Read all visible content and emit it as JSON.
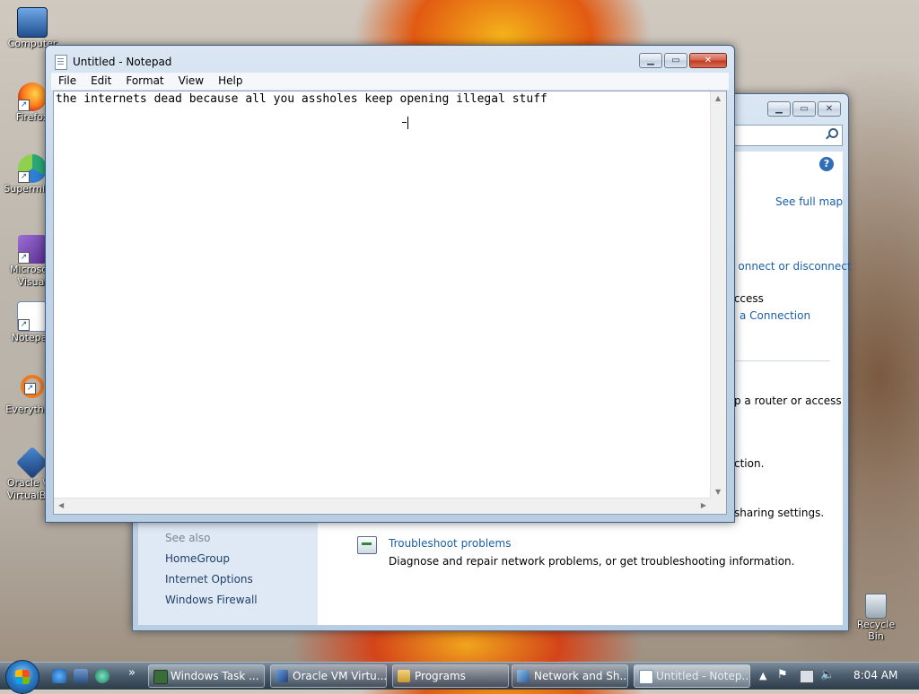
{
  "desktop": {
    "icons": [
      {
        "label": "Computer"
      },
      {
        "label": "Firefox"
      },
      {
        "label": "Supermium"
      },
      {
        "label": "Microsoft Visual Studio"
      },
      {
        "label": "Notepad"
      },
      {
        "label": "Everything"
      },
      {
        "label": "Oracle VM VirtualBox"
      }
    ],
    "recycle_bin": "Recycle Bin"
  },
  "network_window": {
    "see_full_map": "See full map",
    "connect_or_disconnect": "Connect or disconnect",
    "internet_access": "Internet access",
    "a_connection": "a Connection",
    "router_access": "p a router or access",
    "ction": "ction.",
    "sharing_settings": "sharing settings.",
    "see_also": "See also",
    "side_links": [
      "HomeGroup",
      "Internet Options",
      "Windows Firewall"
    ],
    "troubleshoot_title": "Troubleshoot problems",
    "troubleshoot_desc": "Diagnose and repair network problems, or get troubleshooting information."
  },
  "notepad": {
    "title": "Untitled - Notepad",
    "menu": [
      "File",
      "Edit",
      "Format",
      "View",
      "Help"
    ],
    "content": "the internets dead because all you assholes keep opening illegal stuff"
  },
  "taskbar": {
    "buttons": [
      {
        "label": "Windows Task ...",
        "icon": "task-manager-icon"
      },
      {
        "label": "Oracle VM Virtu...",
        "icon": "virtualbox-icon"
      },
      {
        "label": "Programs",
        "icon": "folder-icon"
      },
      {
        "label": "Network and Sh...",
        "icon": "network-icon"
      },
      {
        "label": "Untitled - Notep...",
        "icon": "notepad-icon"
      }
    ],
    "overflow_glyph": "»",
    "clock": "8:04 AM"
  }
}
